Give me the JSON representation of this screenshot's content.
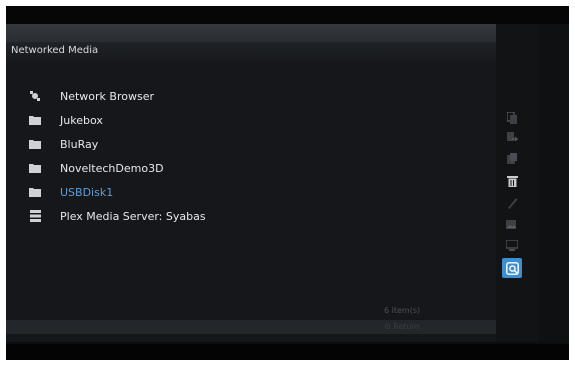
{
  "header": {
    "title": "Networked Media"
  },
  "items": [
    {
      "label": "Network Browser",
      "icon": "network-browser-icon"
    },
    {
      "label": "Jukebox",
      "icon": "folder-icon"
    },
    {
      "label": "BluRay",
      "icon": "folder-icon"
    },
    {
      "label": "NoveltechDemo3D",
      "icon": "folder-icon"
    },
    {
      "label": "USBDisk1",
      "icon": "folder-icon",
      "active": true
    },
    {
      "label": "Plex Media Server: Syabas",
      "icon": "server-icon"
    }
  ],
  "footer": {
    "count": "6 item(s)",
    "return": "⊙ Return"
  },
  "toolbar": [
    {
      "name": "copy-icon"
    },
    {
      "name": "move-icon"
    },
    {
      "name": "paste-icon"
    },
    {
      "name": "delete-icon"
    },
    {
      "name": "rename-icon"
    },
    {
      "name": "image-icon"
    },
    {
      "name": "screen-icon"
    },
    {
      "name": "add-network-share-icon",
      "selected": true
    }
  ],
  "colors": {
    "accent": "#3e8fd0",
    "active_text": "#5d9ed6",
    "text": "#e8e9ea"
  }
}
